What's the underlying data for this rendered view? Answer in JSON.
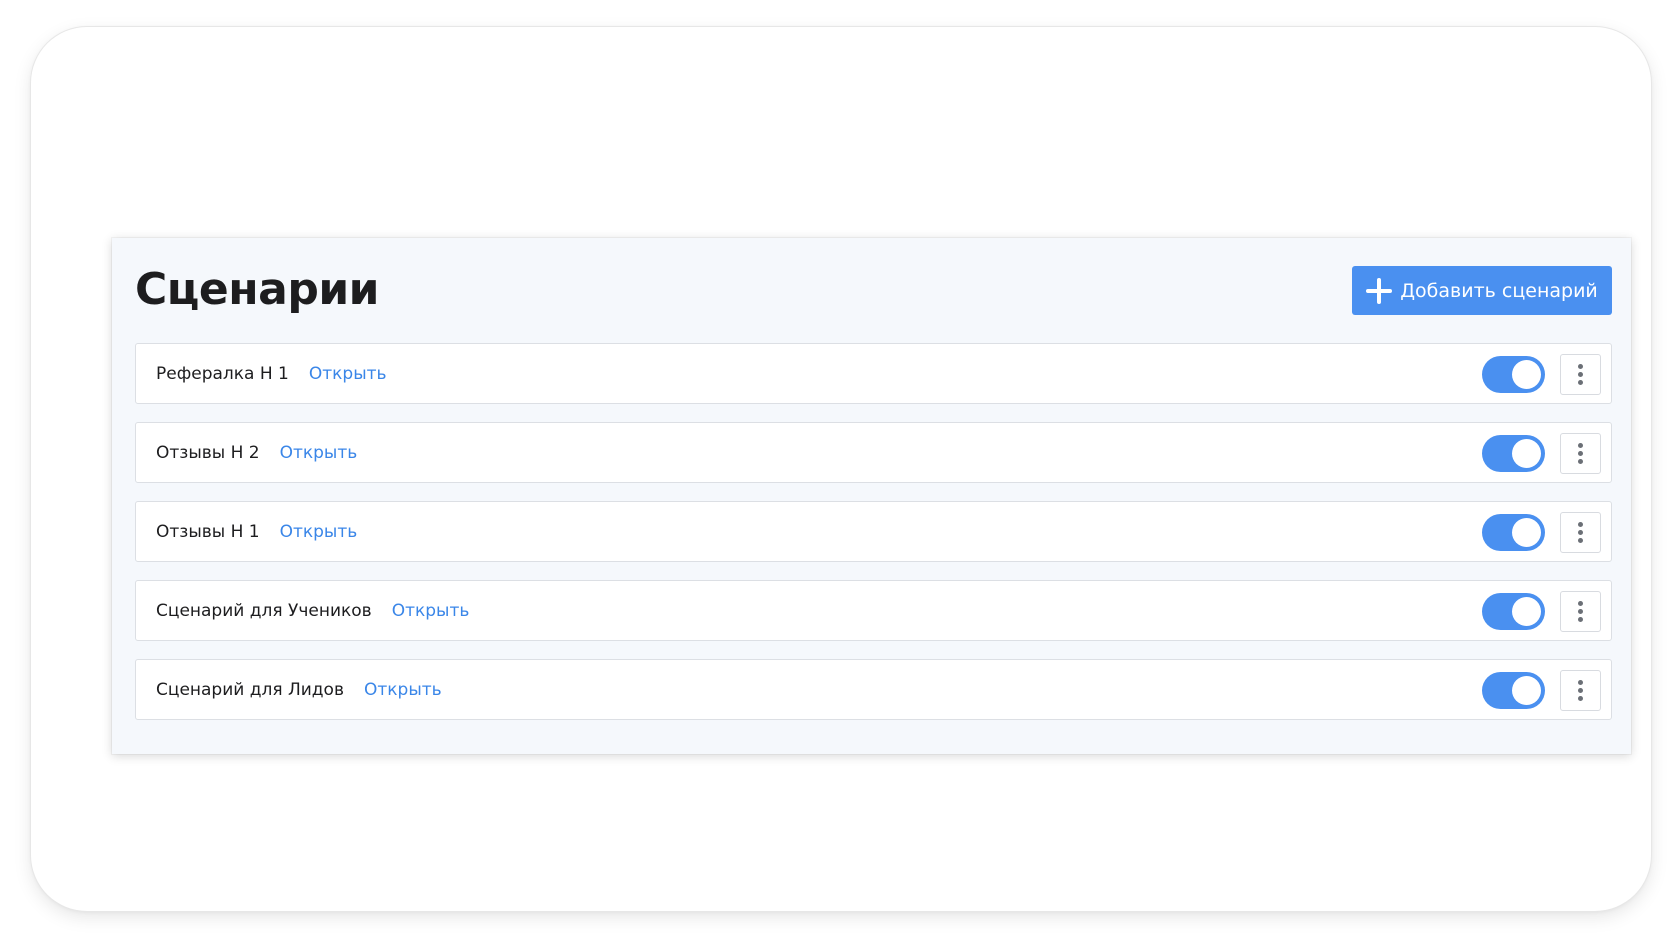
{
  "page": {
    "title": "Сценарии",
    "add_button_label": "Добавить сценарий",
    "add_button_icon": "plus-icon",
    "accent_color": "#4a90f0",
    "link_color": "#3a86e8"
  },
  "scenarios": [
    {
      "name": "Рефералка Н 1",
      "link_label": "Открыть",
      "enabled": true
    },
    {
      "name": "Отзывы Н 2",
      "link_label": "Открыть",
      "enabled": true
    },
    {
      "name": "Отзывы Н 1",
      "link_label": "Открыть",
      "enabled": true
    },
    {
      "name": "Сценарий для Учеников",
      "link_label": "Открыть",
      "enabled": true
    },
    {
      "name": "Сценарий для Лидов",
      "link_label": "Открыть",
      "enabled": true
    }
  ],
  "icons": {
    "menu": "more-vertical-icon"
  }
}
